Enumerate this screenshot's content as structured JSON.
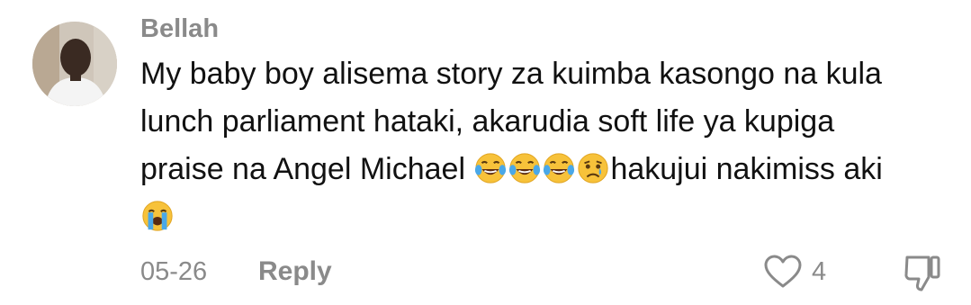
{
  "comment": {
    "username": "Bellah",
    "text_lines": [
      "My baby boy alisema story za kuimba kasongo na kula",
      "lunch parliament hataki, akarudia soft life ya kupiga",
      "praise na Angel Michael ",
      "hakujui nakimiss aki"
    ],
    "emojis": [
      "face-with-tears-of-joy",
      "face-with-tears-of-joy",
      "face-with-tears-of-joy",
      "crying-face",
      "loudly-crying-face"
    ],
    "date": "05-26",
    "reply_label": "Reply",
    "like_count": "4"
  },
  "colors": {
    "meta_gray": "#8a8a8a",
    "text": "#111111",
    "emoji_yellow": "#f7c23a",
    "tear_blue": "#4aa8e8"
  }
}
